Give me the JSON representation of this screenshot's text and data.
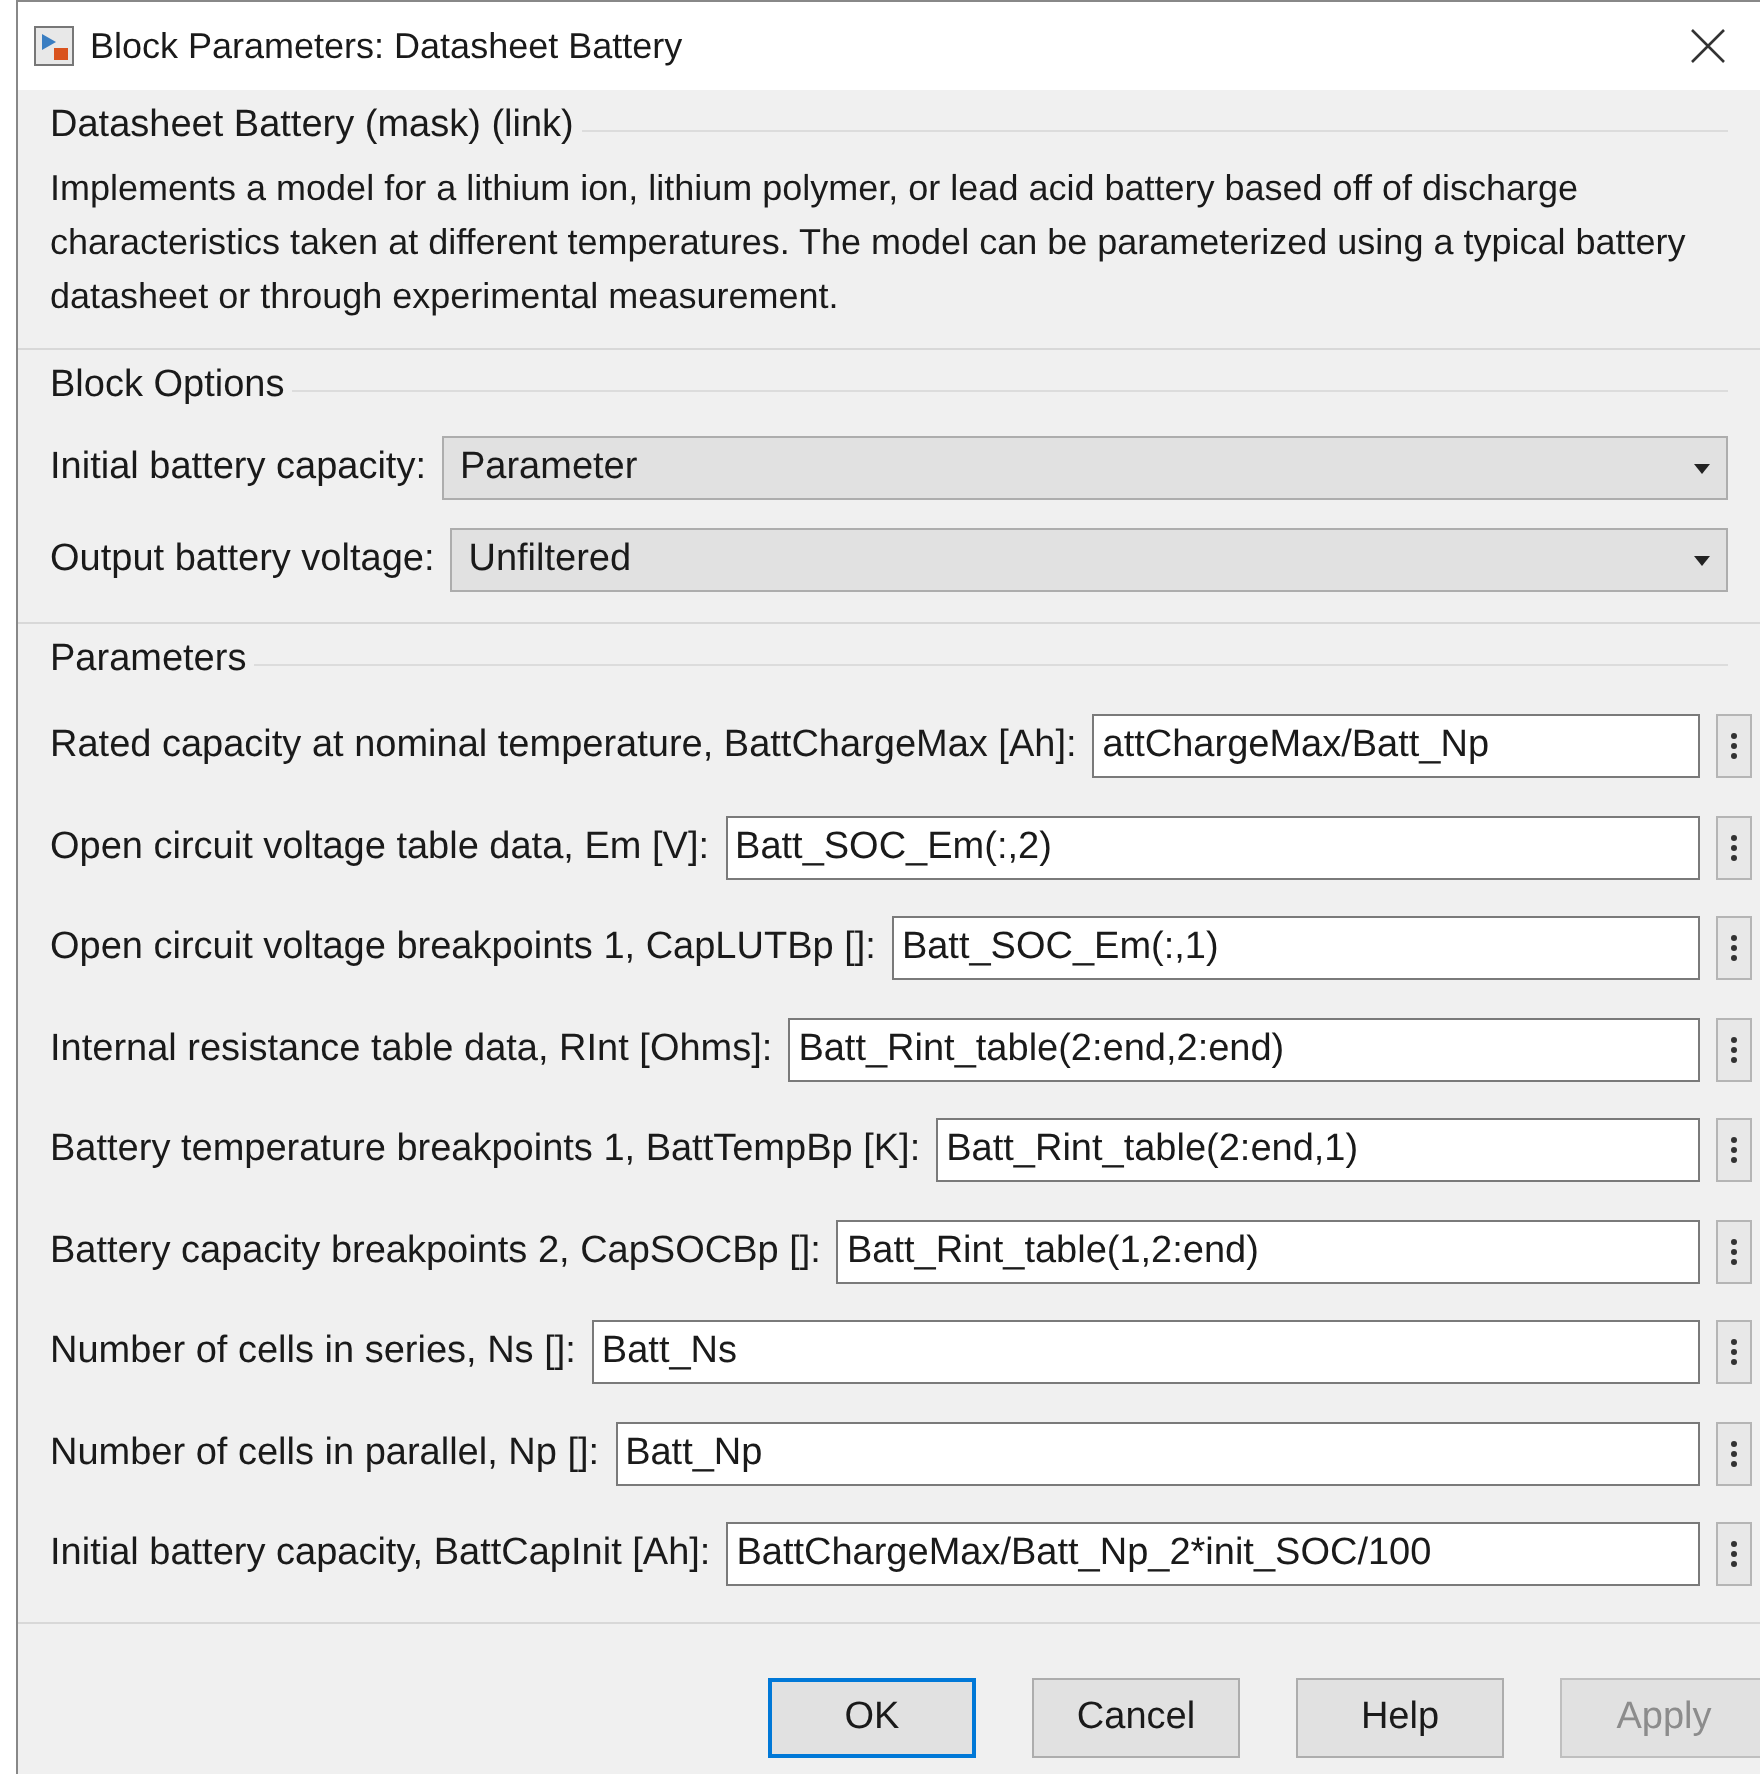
{
  "window": {
    "title": "Block Parameters: Datasheet Battery"
  },
  "mask": {
    "title": "Datasheet Battery (mask) (link)",
    "description": "Implements a model for a lithium ion, lithium polymer, or lead acid battery based off of discharge characteristics taken at different temperatures.  The model can be parameterized using a typical battery datasheet or through experimental measurement."
  },
  "block_options": {
    "title": "Block Options",
    "fields": [
      {
        "label": "Initial battery capacity:",
        "value": "Parameter"
      },
      {
        "label": "Output battery voltage:",
        "value": "Unfiltered"
      }
    ]
  },
  "parameters": {
    "title": "Parameters",
    "fields": [
      {
        "label": "Rated capacity at nominal temperature, BattChargeMax [Ah]:",
        "value": "attChargeMax/Batt_Np"
      },
      {
        "label": "Open circuit voltage table data, Em [V]:",
        "value": "Batt_SOC_Em(:,2)"
      },
      {
        "label": "Open circuit voltage breakpoints 1, CapLUTBp []:",
        "value": "Batt_SOC_Em(:,1)"
      },
      {
        "label": "Internal resistance table data, RInt [Ohms]:",
        "value": "Batt_Rint_table(2:end,2:end)"
      },
      {
        "label": "Battery temperature breakpoints 1, BattTempBp [K]:",
        "value": "Batt_Rint_table(2:end,1)"
      },
      {
        "label": "Battery capacity breakpoints 2, CapSOCBp []:",
        "value": "Batt_Rint_table(1,2:end)"
      },
      {
        "label": "Number of cells in series, Ns []:",
        "value": "Batt_Ns"
      },
      {
        "label": "Number of cells in parallel, Np []:",
        "value": "Batt_Np"
      },
      {
        "label": "Initial battery capacity, BattCapInit [Ah]:",
        "value": "BattChargeMax/Batt_Np_2*init_SOC/100"
      }
    ]
  },
  "buttons": [
    {
      "label": "OK",
      "focused": true,
      "disabled": false
    },
    {
      "label": "Cancel",
      "focused": false,
      "disabled": false
    },
    {
      "label": "Help",
      "focused": false,
      "disabled": false
    },
    {
      "label": "Apply",
      "focused": false,
      "disabled": true
    }
  ]
}
